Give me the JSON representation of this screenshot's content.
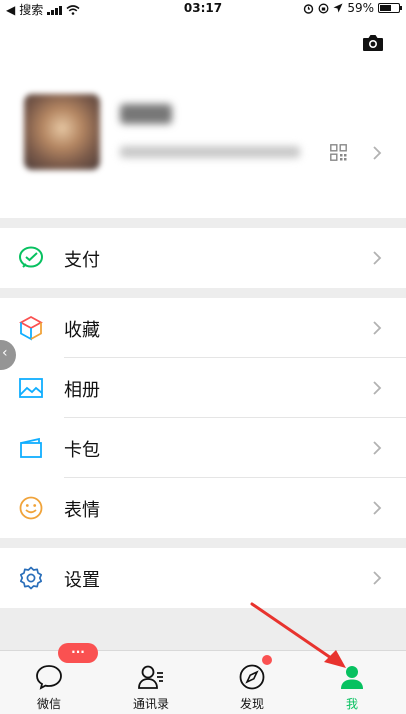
{
  "status_bar": {
    "carrier": "搜索",
    "time": "03:17",
    "battery": "59%",
    "battery_level": 0.59
  },
  "profile": {
    "camera_icon": "camera-icon",
    "qr_icon": "qr-code-icon"
  },
  "menu": {
    "pay": {
      "label": "支付",
      "icon": "wechat-pay-icon"
    },
    "favorites": {
      "label": "收藏",
      "icon": "favorites-cube-icon"
    },
    "album": {
      "label": "相册",
      "icon": "album-image-icon"
    },
    "cards": {
      "label": "卡包",
      "icon": "card-wallet-icon"
    },
    "stickers": {
      "label": "表情",
      "icon": "smiley-icon"
    },
    "settings": {
      "label": "设置",
      "icon": "gear-icon"
    }
  },
  "tabbar": {
    "chats": {
      "label": "微信",
      "badge": "···"
    },
    "contacts": {
      "label": "通讯录"
    },
    "discover": {
      "label": "发现"
    },
    "me": {
      "label": "我"
    }
  },
  "colors": {
    "accent": "#07c160",
    "badge": "#fa5151",
    "arrow": "#e8332e",
    "pay_green": "#07c160",
    "album_blue": "#10aeff",
    "settings_blue": "#2b6fba",
    "sticker_orange": "#f0a33a"
  }
}
